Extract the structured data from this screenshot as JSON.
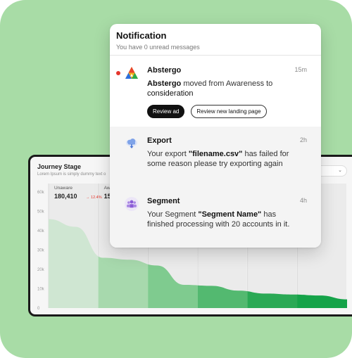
{
  "notification": {
    "title": "Notification",
    "subtitle": "You have 0 unread messages",
    "items": [
      {
        "title": "Abstergo",
        "time": "15m",
        "body_bold": "Abstergo",
        "body_rest": " moved from Awareness to",
        "body_bold2": "consideration",
        "unread": true,
        "actions": [
          "Review ad",
          "Review new landing page"
        ]
      },
      {
        "title": "Export",
        "time": "2h",
        "body_pre": "Your export ",
        "body_bold": "\"filename.csv\"",
        "body_post": " has failed for some reason please try exporting again"
      },
      {
        "title": "Segment",
        "time": "4h",
        "body_pre": "Your Segment ",
        "body_bold": "\"Segment Name\"",
        "body_post": " has finished processing with 20 accounts in it."
      }
    ]
  },
  "chart_data": {
    "type": "area",
    "title": "Journey Stage",
    "subtitle": "Lorem Ipsum is simply dummy text o",
    "ylabel": "",
    "xlabel": "",
    "yticks": [
      "0",
      "10k",
      "20k",
      "30k",
      "40k",
      "50k",
      "60k"
    ],
    "ylim": [
      0,
      60000
    ],
    "stages": [
      {
        "name": "Unaware",
        "value": "180,410",
        "change": "→ 12.4%",
        "color": "#cfe6d2"
      },
      {
        "name": "Awa",
        "value": "154",
        "change": "",
        "color": "#a7d9ad"
      },
      {
        "name": "",
        "value": "",
        "change": "",
        "color": "#7fcb8f"
      },
      {
        "name": "",
        "value": "",
        "change": "",
        "color": "#53b970"
      },
      {
        "name": "",
        "value": "",
        "change": "",
        "color": "#2aa955"
      },
      {
        "name": "",
        "value": "",
        "change": "%",
        "color": "#15a349"
      }
    ],
    "curve": [
      46000,
      42000,
      26000,
      25000,
      22000,
      12000,
      11500,
      9000,
      7500,
      7000,
      6500,
      4500
    ],
    "grid": true
  },
  "colors": {
    "background": "#a8dca6",
    "unread": "#e5362d",
    "chip_primary": "#111111"
  }
}
